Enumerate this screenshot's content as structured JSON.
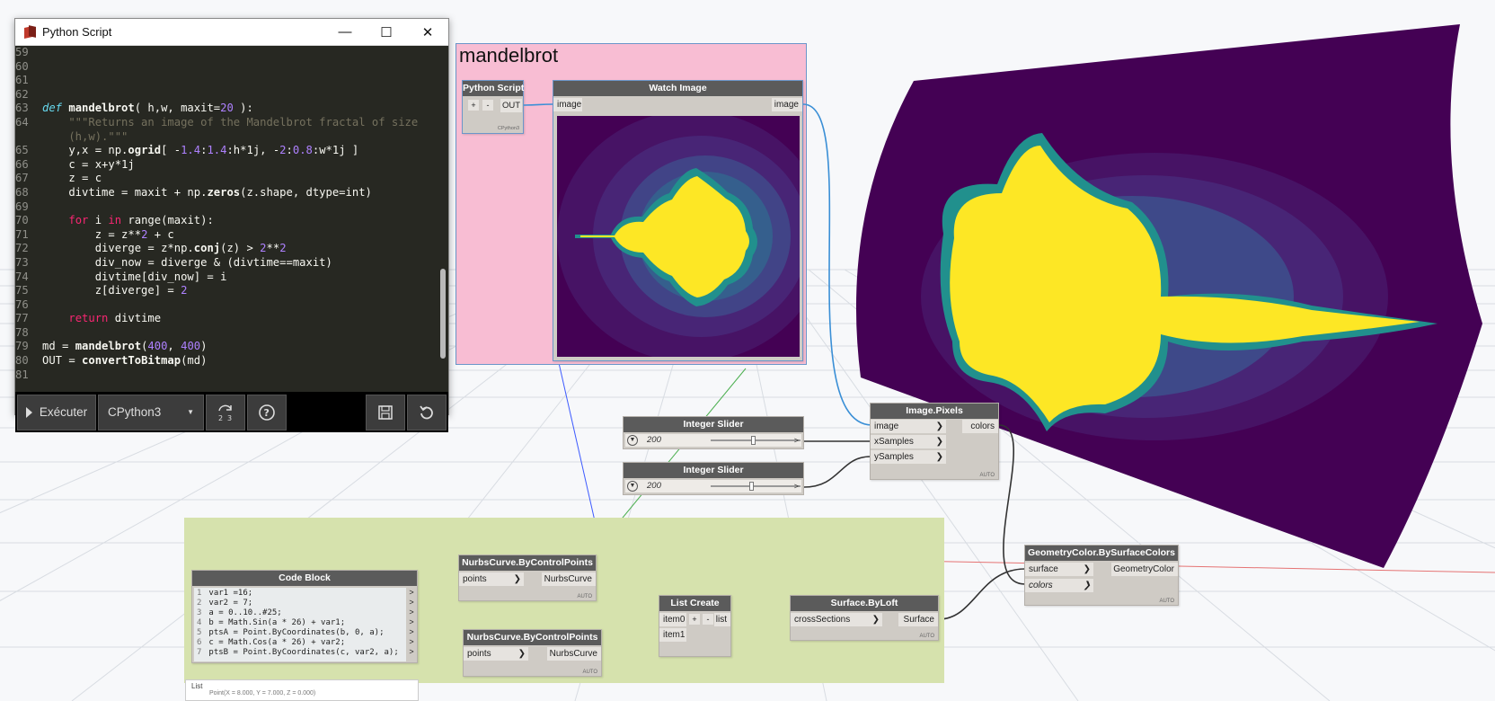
{
  "python_window": {
    "title": "Python Script",
    "controls": {
      "minimize": "—",
      "maximize": "☐",
      "close": "✕"
    },
    "toolbar": {
      "run_label": "Exécuter",
      "engine": "CPython3"
    }
  },
  "code_lines": [
    {
      "n": "59",
      "t": ""
    },
    {
      "n": "60",
      "t": ""
    },
    {
      "n": "61",
      "t": ""
    },
    {
      "n": "62",
      "t": ""
    },
    {
      "n": "63",
      "t": "def mandelbrot( h,w, maxit=20 ):"
    },
    {
      "n": "64",
      "t": "    \"\"\"Returns an image of the Mandelbrot fractal of size"
    },
    {
      "n": "",
      "t": "    (h,w).\"\"\""
    },
    {
      "n": "65",
      "t": "    y,x = np.ogrid[ -1.4:1.4:h*1j, -2:0.8:w*1j ]"
    },
    {
      "n": "66",
      "t": "    c = x+y*1j"
    },
    {
      "n": "67",
      "t": "    z = c"
    },
    {
      "n": "68",
      "t": "    divtime = maxit + np.zeros(z.shape, dtype=int)"
    },
    {
      "n": "69",
      "t": ""
    },
    {
      "n": "70",
      "t": "    for i in range(maxit):"
    },
    {
      "n": "71",
      "t": "        z = z**2 + c"
    },
    {
      "n": "72",
      "t": "        diverge = z*np.conj(z) > 2**2"
    },
    {
      "n": "73",
      "t": "        div_now = diverge & (divtime==maxit)"
    },
    {
      "n": "74",
      "t": "        divtime[div_now] = i"
    },
    {
      "n": "75",
      "t": "        z[diverge] = 2"
    },
    {
      "n": "76",
      "t": ""
    },
    {
      "n": "77",
      "t": "    return divtime"
    },
    {
      "n": "78",
      "t": ""
    },
    {
      "n": "79",
      "t": "md = mandelbrot(400, 400)"
    },
    {
      "n": "80",
      "t": "OUT = convertToBitmap(md)"
    },
    {
      "n": "81",
      "t": ""
    }
  ],
  "group_mandelbrot": {
    "title": "mandelbrot"
  },
  "python_node": {
    "title": "Python Script",
    "plus": "+",
    "minus": "-",
    "output": "OUT",
    "engine_tag": "CPython3"
  },
  "watch_image": {
    "title": "Watch Image",
    "input": "image",
    "output": "image"
  },
  "slider1": {
    "title": "Integer Slider",
    "value": "200",
    "level": 0.5
  },
  "slider2": {
    "title": "Integer Slider",
    "value": "200",
    "level": 0.5
  },
  "image_pixels": {
    "title": "Image.Pixels",
    "inputs": [
      "image",
      "xSamples",
      "ySamples"
    ],
    "output": "colors"
  },
  "geometry_color": {
    "title": "GeometryColor.BySurfaceColors",
    "inputs": [
      "surface",
      "colors"
    ],
    "output": "GeometryColor"
  },
  "code_block": {
    "title": "Code Block",
    "lines": [
      {
        "n": "1",
        "t": "var1 =16;"
      },
      {
        "n": "2",
        "t": "var2 = 7;"
      },
      {
        "n": "3",
        "t": "a = 0..10..#25;"
      },
      {
        "n": "4",
        "t": "b = Math.Sin(a * 26) + var1;"
      },
      {
        "n": "5",
        "t": "ptsA = Point.ByCoordinates(b, 0, a);"
      },
      {
        "n": "6",
        "t": "c = Math.Cos(a * 26) + var2;"
      },
      {
        "n": "7",
        "t": "ptsB = Point.ByCoordinates(c, var2, a);"
      }
    ],
    "preview_title": "List",
    "preview_line": "Point(X = 8.000, Y = 7.000, Z = 0.000)"
  },
  "nurbs1": {
    "title": "NurbsCurve.ByControlPoints",
    "input": "points",
    "output": "NurbsCurve"
  },
  "nurbs2": {
    "title": "NurbsCurve.ByControlPoints",
    "input": "points",
    "output": "NurbsCurve"
  },
  "list_create": {
    "title": "List Create",
    "inputs": [
      "item0",
      "item1"
    ],
    "plus": "+",
    "minus": "-",
    "output": "list"
  },
  "surface_loft": {
    "title": "Surface.ByLoft",
    "input": "crossSections",
    "output": "Surface"
  },
  "auto_tag": "AUTO",
  "colors": {
    "python_bg": "#272822",
    "node_header": "#5b5b5b",
    "node_body": "#cfcbc5",
    "group_pink": "#f8bdd3",
    "group_green": "#d6e2ad",
    "fractal_outer": "#440154",
    "fractal_inner": "#fde725",
    "wire": "#333333",
    "image_wire": "#3a8fd6"
  }
}
